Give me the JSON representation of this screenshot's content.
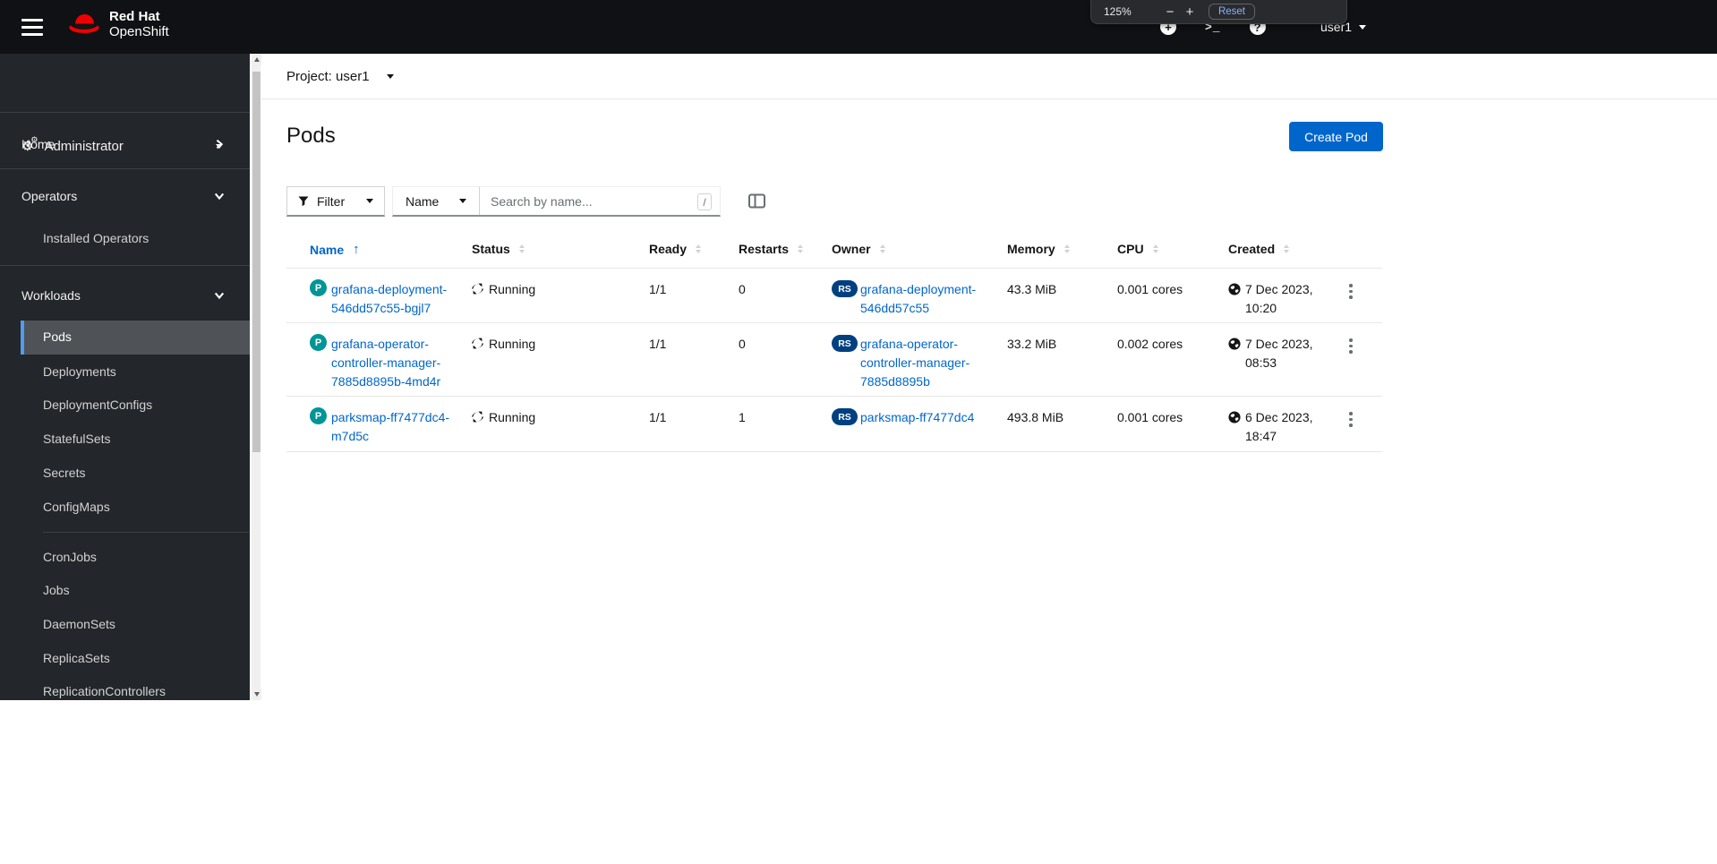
{
  "masthead": {
    "brand_line1": "Red Hat",
    "brand_line2": "OpenShift",
    "username": "user1",
    "icons": {
      "plus": "+",
      "terminal": ">_",
      "question": "?"
    }
  },
  "zoom_popup": {
    "level": "125%",
    "minus": "−",
    "plus": "+",
    "reset_label": "Reset"
  },
  "sidebar": {
    "perspective": "Administrator",
    "gear_glyph": "⚙",
    "home": "Home",
    "operators": "Operators",
    "installed_operators": "Installed Operators",
    "workloads": "Workloads",
    "workloads_items": [
      "Pods",
      "Deployments",
      "DeploymentConfigs",
      "StatefulSets",
      "Secrets",
      "ConfigMaps",
      "CronJobs",
      "Jobs",
      "DaemonSets",
      "ReplicaSets",
      "ReplicationControllers"
    ]
  },
  "project": {
    "label": "Project: user1"
  },
  "page": {
    "title": "Pods",
    "create_button": "Create Pod"
  },
  "toolbar": {
    "filter_label": "Filter",
    "attribute_label": "Name",
    "search_placeholder": "Search by name...",
    "shortcut": "/"
  },
  "table": {
    "columns": [
      "Name",
      "Status",
      "Ready",
      "Restarts",
      "Owner",
      "Memory",
      "CPU",
      "Created"
    ],
    "rows": [
      {
        "badge": "P",
        "name": "grafana-deployment-546dd57c55-bgjl7",
        "status": "Running",
        "ready": "1/1",
        "restarts": "0",
        "owner_badge": "RS",
        "owner": "grafana-deployment-546dd57c55",
        "memory": "43.3 MiB",
        "cpu": "0.001 cores",
        "created_date": "7 Dec 2023,",
        "created_time": "10:20"
      },
      {
        "badge": "P",
        "name": "grafana-operator-controller-manager-7885d8895b-4md4r",
        "status": "Running",
        "ready": "1/1",
        "restarts": "0",
        "owner_badge": "RS",
        "owner": "grafana-operator-controller-manager-7885d8895b",
        "memory": "33.2 MiB",
        "cpu": "0.002 cores",
        "created_date": "7 Dec 2023,",
        "created_time": "08:53"
      },
      {
        "badge": "P",
        "name": "parksmap-ff7477dc4-m7d5c",
        "status": "Running",
        "ready": "1/1",
        "restarts": "1",
        "owner_badge": "RS",
        "owner": "parksmap-ff7477dc4",
        "memory": "493.8 MiB",
        "cpu": "0.001 cores",
        "created_date": "6 Dec 2023,",
        "created_time": "18:47"
      }
    ]
  },
  "colors": {
    "accent": "#0066cc",
    "masthead_bg": "#101114",
    "sidebar_bg": "#23262b",
    "nav_selected_bg": "#4f5357",
    "nav_selected_bar": "#519de9",
    "pod_badge": "#009596",
    "replicaset_badge": "#004080",
    "brand_red": "#ee0000",
    "zoom_popup_bg": "#292a2d",
    "zoom_reset_text": "#8ab4f8"
  }
}
